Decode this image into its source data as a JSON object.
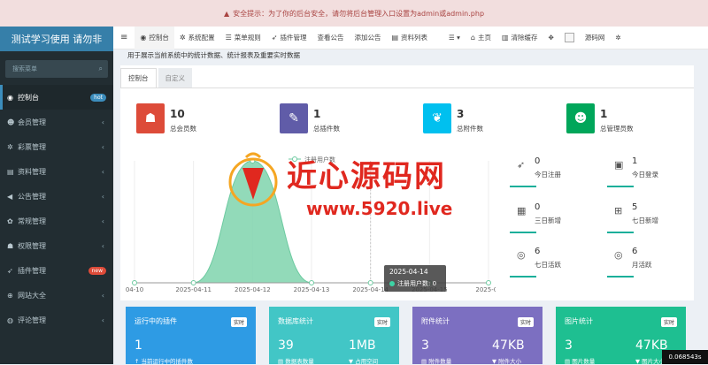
{
  "alert": {
    "text": "安全提示：为了你的后台安全，请勿将后台管理入口设置为admin或admin.php"
  },
  "sidebar": {
    "logo": "测试学习使用 请勿非",
    "search_placeholder": "搜索菜单",
    "items": [
      {
        "label": "控制台",
        "badge": "hot",
        "icon": "dashboard-icon"
      },
      {
        "label": "会员管理",
        "icon": "user-icon"
      },
      {
        "label": "彩票管理",
        "icon": "gears-icon"
      },
      {
        "label": "资料管理",
        "icon": "file-icon"
      },
      {
        "label": "公告管理",
        "icon": "bullhorn-icon"
      },
      {
        "label": "常规管理",
        "icon": "cogs-icon"
      },
      {
        "label": "权限管理",
        "icon": "users-icon"
      },
      {
        "label": "插件管理",
        "badge": "new",
        "icon": "rocket-icon"
      },
      {
        "label": "网站大全",
        "icon": "globe-icon"
      },
      {
        "label": "评论管理",
        "icon": "comments-icon"
      }
    ]
  },
  "topnav": {
    "items": [
      "控制台",
      "系统配置",
      "菜单规则",
      "插件管理",
      "查看公告",
      "添加公告",
      "资料列表"
    ],
    "right": [
      "主页",
      "清除缓存",
      "源码网"
    ]
  },
  "main": {
    "description": "用于展示当前系统中的统计数据、统计报表及重要实时数据",
    "tabs": [
      "控制台",
      "自定义"
    ],
    "stats": [
      {
        "value": "10",
        "label": "总会员数",
        "color": "#dd4b39",
        "icon": "users-icon"
      },
      {
        "value": "1",
        "label": "总插件数",
        "color": "#605ca8",
        "icon": "magic-icon"
      },
      {
        "value": "3",
        "label": "总附件数",
        "color": "#00c0ef",
        "icon": "leaf-icon"
      },
      {
        "value": "1",
        "label": "总管理员数",
        "color": "#00a65a",
        "icon": "user-icon"
      }
    ],
    "right_stats": [
      {
        "value": "0",
        "label": "今日注册",
        "icon": "rocket-icon"
      },
      {
        "value": "1",
        "label": "今日登录",
        "icon": "id-card-icon"
      },
      {
        "value": "0",
        "label": "三日新增",
        "icon": "calendar-icon"
      },
      {
        "value": "5",
        "label": "七日新增",
        "icon": "calendar-plus-icon"
      },
      {
        "value": "6",
        "label": "七日活跃",
        "icon": "user-circle-icon"
      },
      {
        "value": "6",
        "label": "月活跃",
        "icon": "user-circle-icon"
      }
    ],
    "cards": [
      {
        "title": "运行中的插件",
        "badge": "实时",
        "v1": "1",
        "s1": "当前运行中的插件数",
        "color": "#2e9be4"
      },
      {
        "title": "数据库统计",
        "badge": "实时",
        "v1": "39",
        "v2": "1MB",
        "s1": "数据表数量",
        "s2": "占用空间",
        "color": "#42c6c6"
      },
      {
        "title": "附件统计",
        "badge": "实时",
        "v1": "3",
        "v2": "47KB",
        "s1": "附件数量",
        "s2": "附件大小",
        "color": "#7c6fc1"
      },
      {
        "title": "图片统计",
        "badge": "实时",
        "v1": "3",
        "v2": "47KB",
        "s1": "图片数量",
        "s2": "图片大小",
        "color": "#1ebf91"
      }
    ]
  },
  "watermark": {
    "text": "近心源码网",
    "url": "www.5920.live"
  },
  "timer": "0.068543s",
  "chart_data": {
    "type": "area",
    "legend": "注册用户数",
    "x": [
      "04-10",
      "2025-04-11",
      "2025-04-12",
      "2025-04-13",
      "2025-04-14",
      "2025-04-15",
      "2025-04"
    ],
    "values": [
      0,
      0,
      5,
      0,
      0,
      0,
      0
    ],
    "tooltip": {
      "date": "2025-04-14",
      "series": "注册用户数",
      "value": "0"
    }
  }
}
